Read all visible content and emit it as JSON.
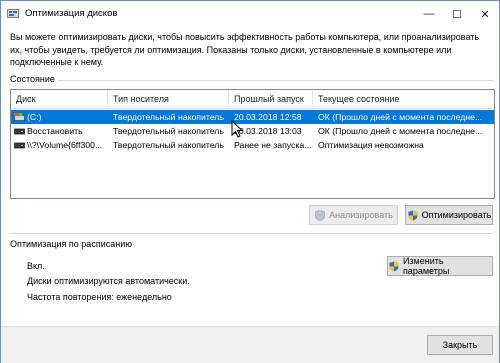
{
  "window": {
    "title": "Оптимизация дисков",
    "minimize_glyph": "—",
    "maximize_glyph": "☐",
    "close_glyph": "✕"
  },
  "intro_text": "Вы можете оптимизировать диски, чтобы повысить эффективность работы  компьютера, или проанализировать их, чтобы увидеть, требуется ли оптимизация. Показаны только диски, установленные в компьютере или подключенные к нему.",
  "status_section": {
    "label": "Состояние",
    "columns": [
      "Диск",
      "Тип носителя",
      "Прошлый запуск",
      "Текущее состояние"
    ],
    "rows": [
      {
        "disk": "(C:)",
        "media": "Твердотельный накопитель",
        "last_run": "20.03.2018 12:58",
        "status": "ОК (Прошло дней с момента последне...",
        "selected": true
      },
      {
        "disk": "Восстановить",
        "media": "Твердотельный накопитель",
        "last_run": "20.03.2018 13:03",
        "status": "ОК (Прошло дней с момента последне...",
        "selected": false
      },
      {
        "disk": "\\\\?\\Volume{6ff300...",
        "media": "Твердотельный накопитель",
        "last_run": "Ранее не запуска...",
        "status": "Оптимизация невозможна",
        "selected": false
      }
    ],
    "analyze_label": "Анализировать",
    "optimize_label": "Оптимизировать"
  },
  "schedule_section": {
    "label": "Оптимизация по расписанию",
    "state": "Вкл.",
    "auto_text": "Диски оптимизируются автоматически.",
    "frequency_text": "Частота повторения: еженедельно",
    "change_settings_label": "Изменить параметры"
  },
  "footer": {
    "close_label": "Закрыть"
  },
  "colors": {
    "selection": "#0078d7",
    "window_border": "#6e8fbf",
    "shield_blue": "#2e6fc4"
  }
}
